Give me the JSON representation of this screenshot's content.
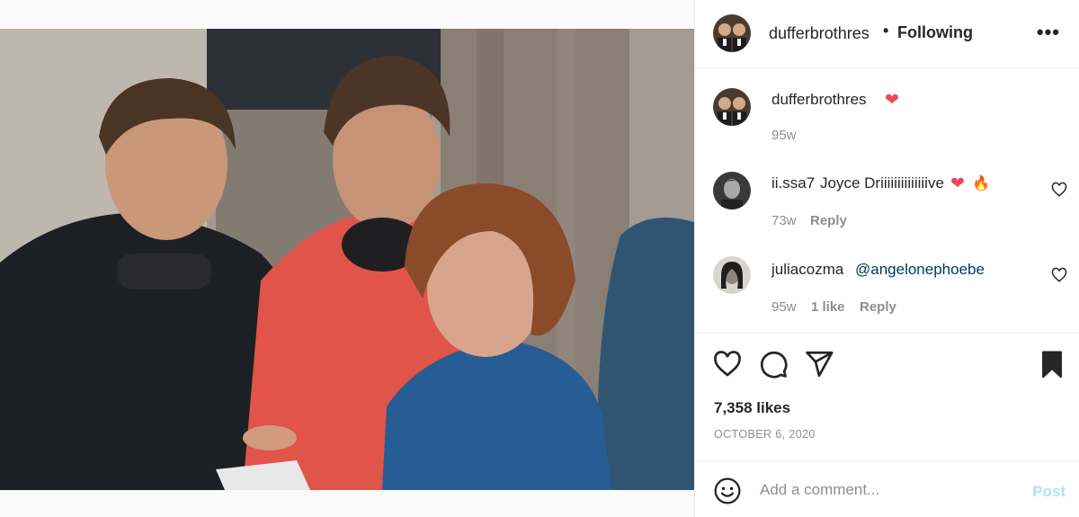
{
  "post": {
    "username": "dufferbrothres",
    "separator": "•",
    "follow_status": "Following",
    "more": "•••",
    "caption": {
      "username": "dufferbrothres",
      "emoji": "❤",
      "time": "95w"
    },
    "comments": [
      {
        "username": "ii.ssa7",
        "text": "Joyce Driiiiiiiiiiiiiive",
        "emoji_heart": "❤",
        "emoji_fire": "🔥",
        "time": "73w",
        "likes": "",
        "reply": "Reply"
      },
      {
        "username": "juliacozma",
        "mention": "@angelonephoebe",
        "time": "95w",
        "likes": "1 like",
        "reply": "Reply"
      }
    ],
    "likes_count": "7,358 likes",
    "date": "OCTOBER 6, 2020",
    "add_comment_placeholder": "Add a comment...",
    "post_label": "Post"
  },
  "icons": {
    "like": "heart-icon",
    "comment": "comment-icon",
    "share": "paper-plane-icon",
    "save": "bookmark-icon",
    "emoji": "smiley-icon",
    "more": "more-horizontal-icon"
  },
  "colors": {
    "heart": "#ed4956",
    "mention": "#00376b",
    "muted": "#8e8e8e",
    "post_disabled": "#b2dffc",
    "border": "#efefef"
  }
}
